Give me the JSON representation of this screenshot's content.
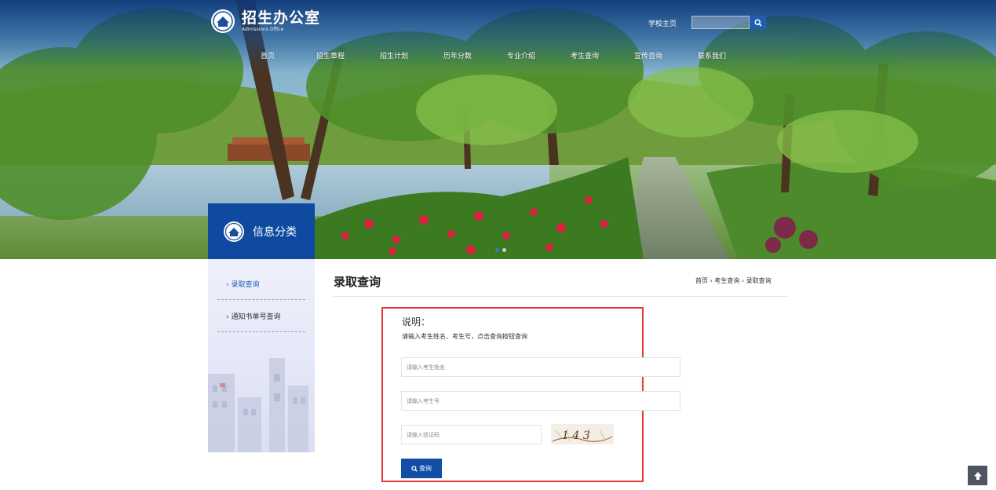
{
  "site": {
    "logo_cn": "招生办公室",
    "logo_en": "Admissions Office",
    "school_home": "学校主页"
  },
  "nav": [
    {
      "label": "首页"
    },
    {
      "label": "招生章程"
    },
    {
      "label": "招生计划"
    },
    {
      "label": "历年分数"
    },
    {
      "label": "专业介绍"
    },
    {
      "label": "考生查询"
    },
    {
      "label": "宣传咨询"
    },
    {
      "label": "联系我们"
    }
  ],
  "sidebar": {
    "title": "信息分类",
    "items": [
      {
        "label": "› 录取查询"
      },
      {
        "label": "› 通知书单号查询"
      }
    ]
  },
  "main": {
    "title": "录取查询",
    "breadcrumb": {
      "home": "首页",
      "sep": " › ",
      "parent": "考生查询",
      "current": "录取查询"
    },
    "note_label": "说明：",
    "note_text": "请输入考生姓名、考生号，点击查询按钮查询",
    "name_placeholder": "请输入考生姓名",
    "id_placeholder": "请输入考生号",
    "captcha_placeholder": "请输入验证码",
    "captcha_text": "1 4 3",
    "query_label": "查询"
  },
  "colors": {
    "primary": "#124ea6",
    "frame": "#e53935",
    "sidebar_head": "#0d4aa0"
  }
}
